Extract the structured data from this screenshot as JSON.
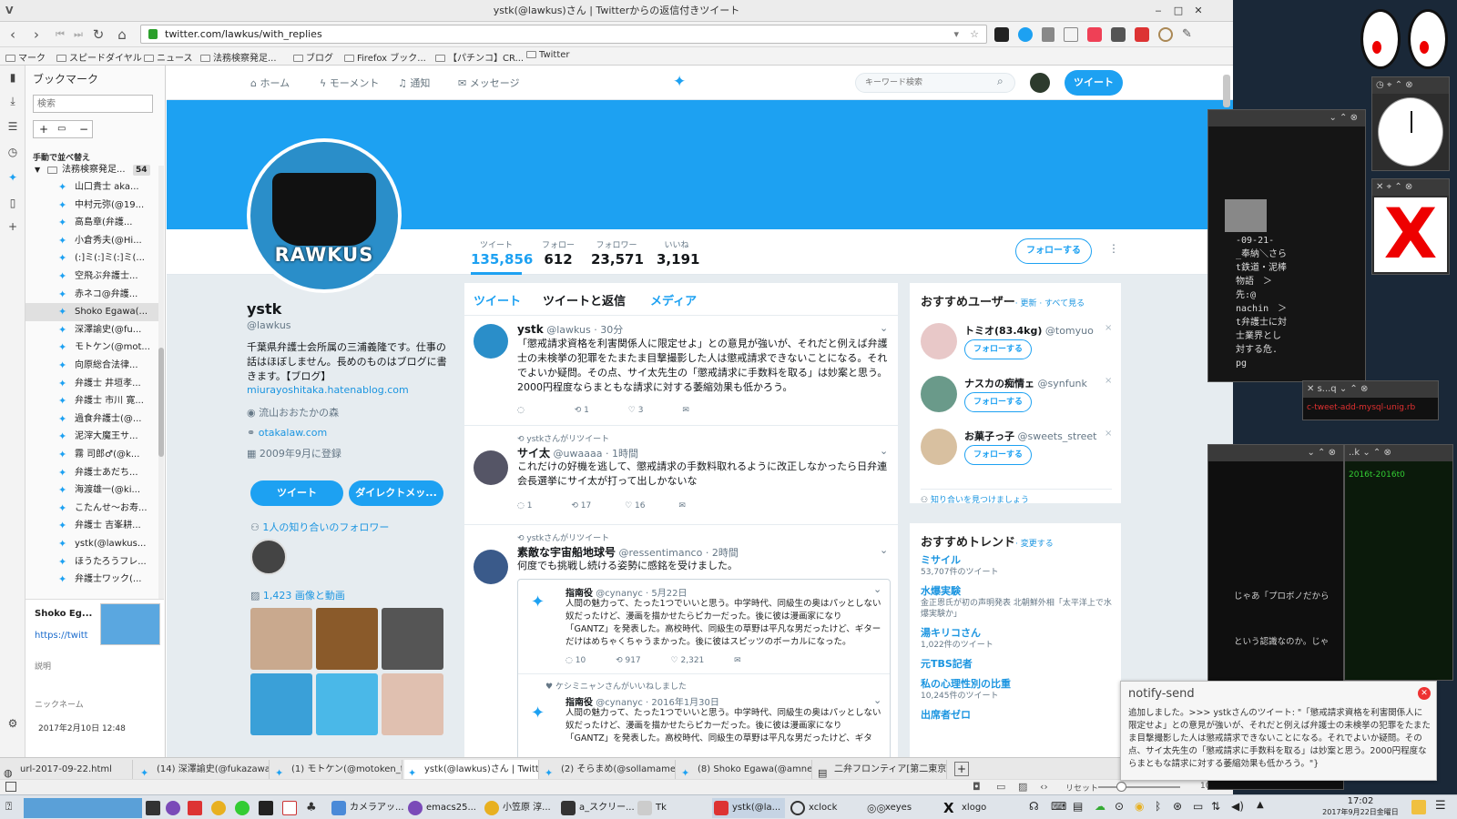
{
  "window": {
    "title": "ystk(@lawkus)さん | Twitterからの返信付きツイート",
    "min": "‒",
    "max": "□",
    "close": "✕",
    "appmenu": "V"
  },
  "nav": {
    "url": "twitter.com/lawkus/with_replies",
    "back_icon": "arrow-left-icon",
    "forward_icon": "arrow-right-icon",
    "reload_icon": "reload-icon",
    "home_icon": "home-icon"
  },
  "bookmarks_bar": [
    "マーク",
    "スピードダイヤル",
    "ニュース",
    "法務検察発足...",
    "ブログ",
    "Firefox ブック...",
    "【パチンコ】CR...",
    "Twitter"
  ],
  "sidebar": {
    "title": "ブックマーク",
    "search_placeholder": "検索",
    "sort_label": "手動で並べ替え",
    "folder": {
      "label": "法務検察発足...",
      "count": "54"
    },
    "items": [
      "山口貴士 aka...",
      "中村元弥(@19...",
      "高島章(弁護...",
      "小倉秀夫(@Hi...",
      "(:]ミ(:]ミ(:]ミ(...",
      "空飛ぶ弁護士...",
      "赤ネコ@弁護...",
      "Shoko Egawa(...",
      "深澤諭史(@fu...",
      "モトケン(@mot...",
      "向原総合法律...",
      "弁護士 井垣孝...",
      "弁護士 市川 寛...",
      "過食弁護士(@...",
      "泥滓大魔王サ...",
      "霧 司郎♂(@k...",
      "弁護士あだち...",
      "海渡雄一(@ki...",
      "こたんせ〜お寿...",
      "弁護士 吉峯耕...",
      "ystk(@lawkus...",
      "ほうたろうフレ...",
      "弁護士ワック(..."
    ],
    "preview": {
      "title": "Shoko Eg...",
      "url": "https://twitt",
      "desc_label": "説明",
      "nick_label": "ニックネーム",
      "date": "2017年2月10日 12:48"
    }
  },
  "twitter": {
    "nav": {
      "home": "ホーム",
      "moments": "モーメント",
      "notifications": "通知",
      "messages": "メッセージ"
    },
    "search_placeholder": "キーワード検索",
    "tweet_button": "ツイート",
    "banner_color": "#1da1f2",
    "stats": [
      {
        "label": "ツイート",
        "value": "135,856"
      },
      {
        "label": "フォロー",
        "value": "612"
      },
      {
        "label": "フォロワー",
        "value": "23,571"
      },
      {
        "label": "いいね",
        "value": "3,191"
      }
    ],
    "follow_button": "フォローする",
    "profile": {
      "logo_text": "RAWKUS",
      "name": "ystk",
      "handle": "@lawkus",
      "bio": "千葉県弁護士会所属の三浦義隆です。仕事の話はほぼしません。長めのものはブログに書きます。【ブログ】",
      "blog_url": "miurayoshitaka.hatenablog.com",
      "location": "流山おおたかの森",
      "website": "otakalaw.com",
      "joined": "2009年9月に登録",
      "tweet_btn": "ツイート",
      "dm_btn": "ダイレクトメッ...",
      "followers_you_know": "1人の知り合いのフォロワー",
      "media_label": "1,423 画像と動画"
    },
    "tabs": [
      "ツイート",
      "ツイートと返信",
      "メディア"
    ],
    "tweets": [
      {
        "name": "ystk",
        "handle": "@lawkus",
        "time": "· 30分",
        "text": "「懲戒請求資格を利害関係人に限定せよ」との意見が強いが、それだと例えば弁護士の未検挙の犯罪をたまたま目撃撮影した人は懲戒請求できないことになる。それでよいか疑問。その点、サイ太先生の「懲戒請求に手数料を取る」は妙案と思う。2000円程度ならまともな請求に対する萎縮効果も低かろう。",
        "retweets": "1",
        "likes": "3"
      },
      {
        "rt_label": "ystkさんがリツイート",
        "name": "サイ太",
        "handle": "@uwaaaa",
        "time": "· 1時間",
        "text": "これだけの好機を逃して、懲戒請求の手数料取れるように改正しなかったら日弁連会長選挙にサイ太が打って出しかないな",
        "replies": "1",
        "retweets": "17",
        "likes": "16"
      },
      {
        "rt_label": "ystkさんがリツイート",
        "name": "素敵な宇宙船地球号",
        "handle": "@ressentimanco",
        "time": "· 2時間",
        "text": "何度でも挑戦し続ける姿勢に感銘を受けました。",
        "quote": {
          "name": "指南役",
          "handle": "@cynanyc",
          "time": "· 5月22日",
          "text": "人間の魅力って、たった1つでいいと思う。中学時代、同級生の奥はパッとしない奴だったけど、漫画を描かせたらピカ一だった。後に彼は漫画家になり「GANTZ」を発表した。高校時代、同級生の草野は平凡な男だったけど、ギターだけはめちゃくちゃうまかった。後に彼はスピッツのボーカルになった。",
          "replies": "10",
          "retweets": "917",
          "likes": "2,321"
        },
        "liked_label": "ケシミニャンさんがいいねしました",
        "quote2": {
          "name": "指南役",
          "handle": "@cynanyc",
          "time": "· 2016年1月30日",
          "text": "人間の魅力って、たった1つでいいと思う。中学時代、同級生の奥はパッとしない奴だったけど、漫画を描かせたらピカ一だった。後に彼は漫画家になり「GANTZ」を発表した。高校時代、同級生の草野は平凡な男だったけど、ギタ"
        }
      }
    ],
    "who_to_follow": {
      "title": "おすすめユーザー",
      "refresh": "· 更新 · すべて見る",
      "users": [
        {
          "name": "トミオ(83.4kg)",
          "handle": "@tomyuo"
        },
        {
          "name": "ナスカの痴情ェ",
          "handle": "@synfunk"
        },
        {
          "name": "お菓子っ子",
          "handle": "@sweets_street"
        }
      ],
      "follow_label": "フォローする",
      "find_friends": "知り合いを見つけましょう"
    },
    "trends": {
      "title": "おすすめトレンド",
      "change": "· 変更する",
      "items": [
        {
          "name": "ミサイル",
          "meta": "53,707件のツイート"
        },
        {
          "name": "水爆実験",
          "meta": "金正恩氏が初の声明発表 北朝鮮外相「太平洋上で水爆実験か」"
        },
        {
          "name": "湯キリコさん",
          "meta": "1,022件のツイート"
        },
        {
          "name": "元TBS記者",
          "meta": ""
        },
        {
          "name": "私の心理性別の比重",
          "meta": "10,245件のツイート"
        },
        {
          "name": "出席者ゼロ",
          "meta": ""
        }
      ]
    }
  },
  "tabs": [
    "url-2017-09-22.html",
    "(14) 深澤諭史(@fukazawas",
    "(1) モトケン(@motoken_tw(",
    "ystk(@lawkus)さん | Twitte",
    "(2) そらまめ(@sollamame)さ",
    "(8) Shoko Egawa(@amneris",
    "二弁フロンティア[第二東京弁"
  ],
  "statusbar": {
    "reset": "リセット",
    "zoom": "100 %"
  },
  "notify": {
    "title": "notify-send",
    "body": "追加しました。>>> ystkさんのツイート: \"「懲戒請求資格を利害関係人に限定せよ」との意見が強いが、それだと例えば弁護士の未検挙の犯罪をたまたま目撃撮影した人は懲戒請求できないことになる。それでよいか疑問。その点、サイ太先生の「懲戒請求に手数料を取る」は妙案と思う。2000円程度ならまともな請求に対する萎縮効果も低かろう。\"}"
  },
  "taskbar": {
    "tasks": [
      "カメラアッ...",
      "emacs25...",
      "小笠原 淳...",
      "a_スクリー...",
      "Tk",
      "ystk(@la...",
      "xclock",
      "xeyes",
      "xlogo"
    ],
    "time": "17:02",
    "date": "2017年9月22日金曜日"
  },
  "desktop": {
    "terminal_lines": [
      "-09-21-",
      "_奉納＼さら",
      "t鉄道・泥棒",
      "物語　＞",
      "先:@",
      "nachin　＞",
      "t弁護士に対",
      "士業界とし",
      "対する危.",
      "pg"
    ],
    "small_win_title": "s...q",
    "small_win_text": "c-tweet-add-mysql-unig.rb",
    "term2_title": "..k",
    "term2_text": "2016t-2016t0",
    "term3_lines": [
      "じゃあ「プロボノだから",
      "という認識なのか。じゃ"
    ]
  }
}
